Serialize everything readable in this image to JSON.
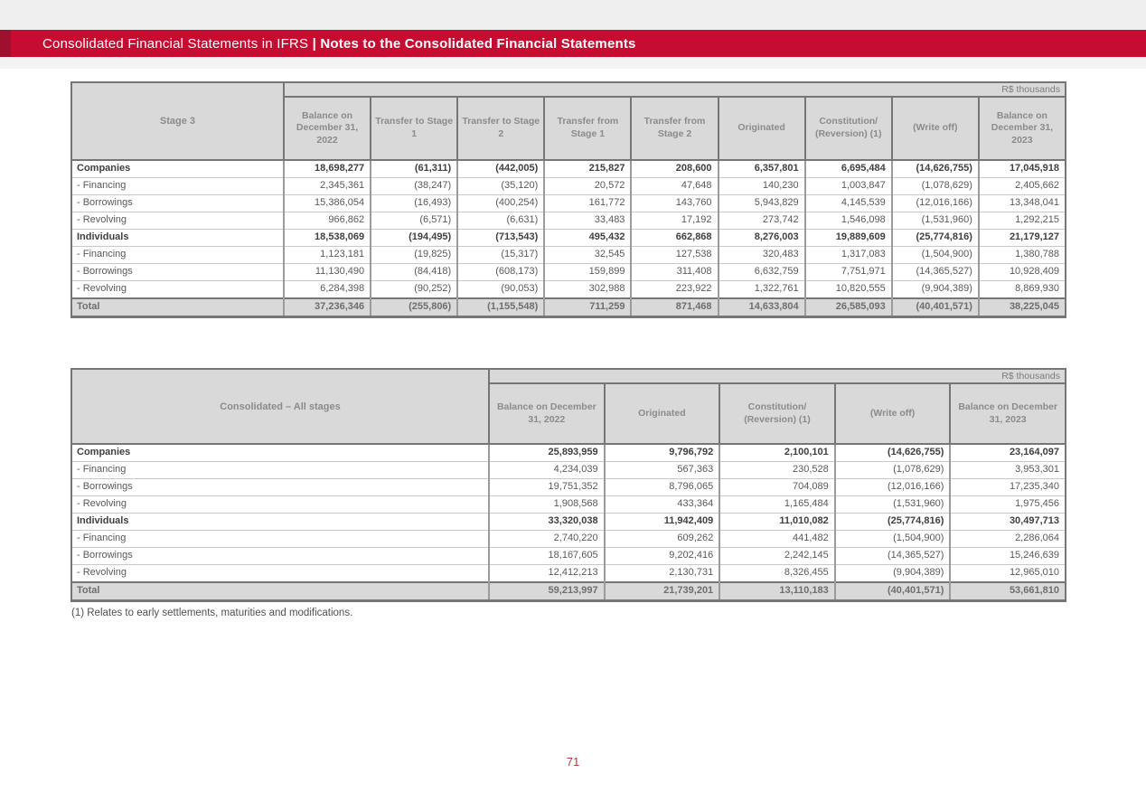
{
  "header": {
    "title_regular": "Consolidated Financial Statements in IFRS",
    "separator": "|",
    "title_bold": "Notes to the Consolidated Financial Statements"
  },
  "footnote": "(1) Relates to early settlements, maturities and modifications.",
  "page_number": "71",
  "colors": {
    "brand_red": "#c60c30",
    "brand_red_dark": "#9f0f2e",
    "header_cell_gray": "#d9d9d9",
    "table_border_gray": "#767676",
    "body_text_gray": "#595959",
    "page_number_red": "#b23842"
  },
  "table1": {
    "corner_label": "Stage 3",
    "unit_label": "R$ thousands",
    "columns": [
      "Balance on December 31, 2022",
      "Transfer to Stage 1",
      "Transfer to Stage 2",
      "Transfer from Stage 1",
      "Transfer from Stage 2",
      "Originated",
      "Constitution/ (Reversion) (1)",
      "(Write off)",
      "Balance on December 31, 2023"
    ],
    "rows": [
      {
        "label": "Companies",
        "bold": true,
        "values": [
          "18,698,277",
          "(61,311)",
          "(442,005)",
          "215,827",
          "208,600",
          "6,357,801",
          "6,695,484",
          "(14,626,755)",
          "17,045,918"
        ]
      },
      {
        "label": "- Financing",
        "bold": false,
        "values": [
          "2,345,361",
          "(38,247)",
          "(35,120)",
          "20,572",
          "47,648",
          "140,230",
          "1,003,847",
          "(1,078,629)",
          "2,405,662"
        ]
      },
      {
        "label": "- Borrowings",
        "bold": false,
        "values": [
          "15,386,054",
          "(16,493)",
          "(400,254)",
          "161,772",
          "143,760",
          "5,943,829",
          "4,145,539",
          "(12,016,166)",
          "13,348,041"
        ]
      },
      {
        "label": "- Revolving",
        "bold": false,
        "values": [
          "966,862",
          "(6,571)",
          "(6,631)",
          "33,483",
          "17,192",
          "273,742",
          "1,546,098",
          "(1,531,960)",
          "1,292,215"
        ]
      },
      {
        "label": "Individuals",
        "bold": true,
        "values": [
          "18,538,069",
          "(194,495)",
          "(713,543)",
          "495,432",
          "662,868",
          "8,276,003",
          "19,889,609",
          "(25,774,816)",
          "21,179,127"
        ]
      },
      {
        "label": "- Financing",
        "bold": false,
        "values": [
          "1,123,181",
          "(19,825)",
          "(15,317)",
          "32,545",
          "127,538",
          "320,483",
          "1,317,083",
          "(1,504,900)",
          "1,380,788"
        ]
      },
      {
        "label": "- Borrowings",
        "bold": false,
        "values": [
          "11,130,490",
          "(84,418)",
          "(608,173)",
          "159,899",
          "311,408",
          "6,632,759",
          "7,751,971",
          "(14,365,527)",
          "10,928,409"
        ]
      },
      {
        "label": "- Revolving",
        "bold": false,
        "values": [
          "6,284,398",
          "(90,252)",
          "(90,053)",
          "302,988",
          "223,922",
          "1,322,761",
          "10,820,555",
          "(9,904,389)",
          "8,869,930"
        ]
      }
    ],
    "total": {
      "label": "Total",
      "values": [
        "37,236,346",
        "(255,806)",
        "(1,155,548)",
        "711,259",
        "871,468",
        "14,633,804",
        "26,585,093",
        "(40,401,571)",
        "38,225,045"
      ]
    }
  },
  "table2": {
    "corner_label": "Consolidated – All stages",
    "unit_label": "R$ thousands",
    "columns": [
      "Balance on December 31, 2022",
      "Originated",
      "Constitution/ (Reversion) (1)",
      "(Write off)",
      "Balance on December 31, 2023"
    ],
    "rows": [
      {
        "label": "Companies",
        "bold": true,
        "values": [
          "25,893,959",
          "9,796,792",
          "2,100,101",
          "(14,626,755)",
          "23,164,097"
        ]
      },
      {
        "label": "- Financing",
        "bold": false,
        "values": [
          "4,234,039",
          "567,363",
          "230,528",
          "(1,078,629)",
          "3,953,301"
        ]
      },
      {
        "label": "- Borrowings",
        "bold": false,
        "values": [
          "19,751,352",
          "8,796,065",
          "704,089",
          "(12,016,166)",
          "17,235,340"
        ]
      },
      {
        "label": "- Revolving",
        "bold": false,
        "values": [
          "1,908,568",
          "433,364",
          "1,165,484",
          "(1,531,960)",
          "1,975,456"
        ]
      },
      {
        "label": "Individuals",
        "bold": true,
        "values": [
          "33,320,038",
          "11,942,409",
          "11,010,082",
          "(25,774,816)",
          "30,497,713"
        ]
      },
      {
        "label": "- Financing",
        "bold": false,
        "values": [
          "2,740,220",
          "609,262",
          "441,482",
          "(1,504,900)",
          "2,286,064"
        ]
      },
      {
        "label": "- Borrowings",
        "bold": false,
        "values": [
          "18,167,605",
          "9,202,416",
          "2,242,145",
          "(14,365,527)",
          "15,246,639"
        ]
      },
      {
        "label": "- Revolving",
        "bold": false,
        "values": [
          "12,412,213",
          "2,130,731",
          "8,326,455",
          "(9,904,389)",
          "12,965,010"
        ]
      }
    ],
    "total": {
      "label": "Total",
      "values": [
        "59,213,997",
        "21,739,201",
        "13,110,183",
        "(40,401,571)",
        "53,661,810"
      ]
    }
  }
}
